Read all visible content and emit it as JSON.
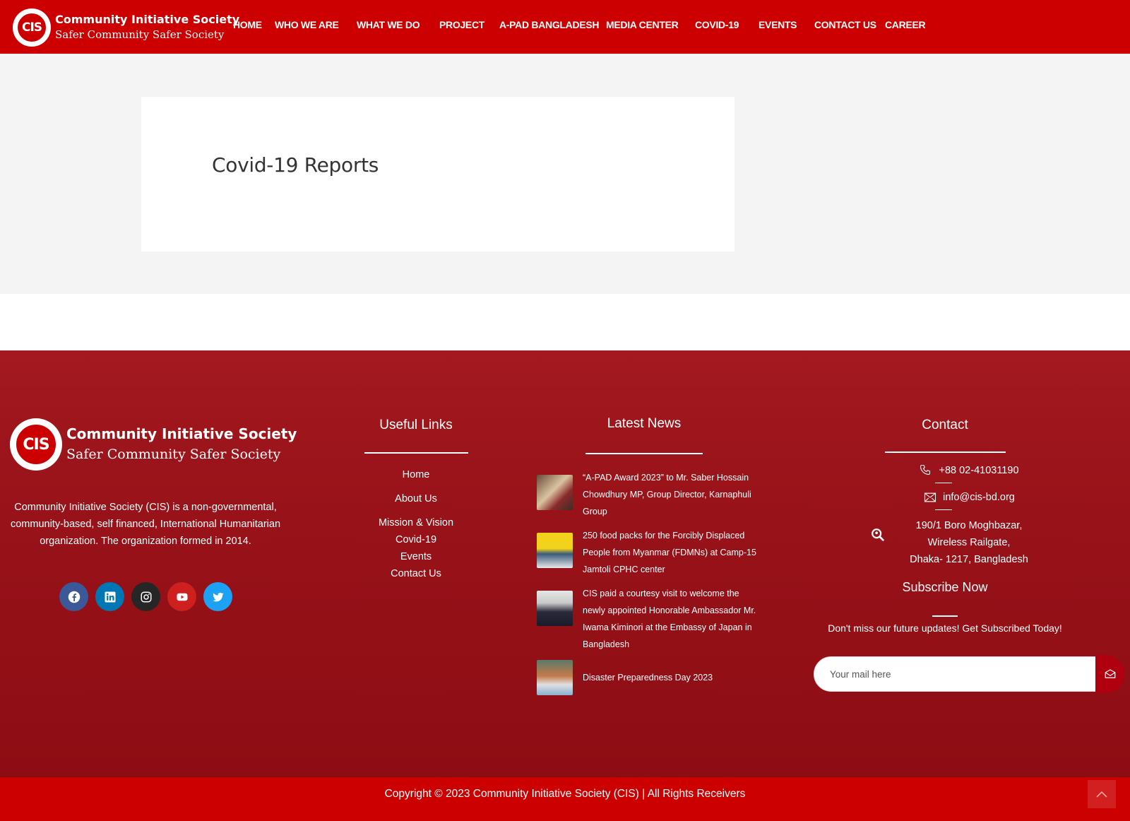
{
  "header": {
    "logo_badge": "CIS",
    "logo_title": "Community Initiative Society",
    "logo_tagline": "Safer Community Safer Society",
    "nav": [
      "HOME",
      "WHO WE ARE",
      "WHAT WE DO",
      "PROJECT",
      "A-PAD BANGLADESH",
      "MEDIA CENTER",
      "COVID-19",
      "EVENTS",
      "CONTACT US",
      "CAREER"
    ]
  },
  "main": {
    "page_title": "Covid-19 Reports"
  },
  "footer": {
    "logo_badge": "CIS",
    "logo_title": "Community Initiative Society",
    "logo_tagline": "Safer Community Safer Society",
    "description": "Community Initiative Society (CIS) is a non-governmental, community-based, self financed, International Humanitarian organization. The organization formed in 2014.",
    "socials": [
      "facebook-icon",
      "linkedin-icon",
      "instagram-icon",
      "youtube-icon",
      "twitter-icon"
    ],
    "useful_links": {
      "title": "Useful Links",
      "items": [
        "Home",
        "About Us",
        "Mission & Vision",
        "Covid-19",
        "Events",
        "Contact Us"
      ]
    },
    "latest_news": {
      "title": "Latest News",
      "items": [
        "“A-PAD Award 2023” to Mr. Saber Hossain Chowdhury MP, Group Director, Karnaphuli Group",
        "250 food packs for the Forcibly Displaced People from Myanmar (FDMNs) at Camp-15 Jamtoli CPHC center",
        "CIS paid a courtesy visit to welcome the newly appointed Honorable Ambassador Mr. Iwama Kiminori at the Embassy of Japan in Bangladesh",
        "Disaster Preparedness Day 2023"
      ]
    },
    "contact": {
      "title": "Contact",
      "phone": "+88 02-41031190",
      "email": "info@cis-bd.org",
      "address_line1": "190/1 Boro Moghbazar,",
      "address_line2": "Wireless Railgate,",
      "address_line3": "Dhaka- 1217, Bangladesh"
    },
    "subscribe": {
      "title": "Subscribe Now",
      "text": "Don't miss our future updates! Get Subscribed Today!",
      "placeholder": "Your mail here"
    },
    "copyright": "Copyright © 2023 Community Initiative Society (CIS) | All Rights Receivers"
  },
  "colors": {
    "brand_red": "#cc0000",
    "footer_red": "#981219",
    "facebook": "#3b5998",
    "linkedin": "#0077b5",
    "instagram": "#262626",
    "youtube": "#cd201f",
    "twitter": "#1da1f2"
  }
}
